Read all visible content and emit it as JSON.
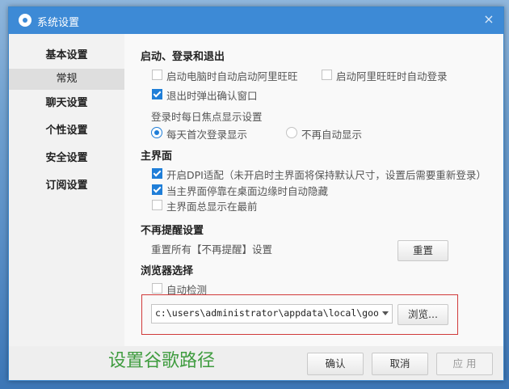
{
  "window": {
    "title": "系统设置",
    "close_glyph": "×"
  },
  "sidebar": {
    "items": [
      {
        "label": "基本设置"
      },
      {
        "label": "常规"
      },
      {
        "label": "聊天设置"
      },
      {
        "label": "个性设置"
      },
      {
        "label": "安全设置"
      },
      {
        "label": "订阅设置"
      }
    ]
  },
  "startup": {
    "title": "启动、登录和退出",
    "auto_start": {
      "label": "启动电脑时自动启动阿里旺旺",
      "checked": false
    },
    "auto_login": {
      "label": "启动阿里旺旺时自动登录",
      "checked": false
    },
    "exit_confirm": {
      "label": "退出时弹出确认窗口",
      "checked": true
    },
    "focus_label": "登录时每日焦点显示设置",
    "focus_first": {
      "label": "每天首次登录显示",
      "selected": true
    },
    "focus_never": {
      "label": "不再自动显示",
      "selected": false
    }
  },
  "main_ui": {
    "title": "主界面",
    "dpi": {
      "label": "开启DPI适配（未开启时主界面将保持默认尺寸，设置后需要重新登录）",
      "checked": true
    },
    "auto_hide": {
      "label": "当主界面停靠在桌面边缘时自动隐藏",
      "checked": true
    },
    "always_top": {
      "label": "主界面总显示在最前",
      "checked": false
    }
  },
  "reminder": {
    "title": "不再提醒设置",
    "label": "重置所有【不再提醒】设置",
    "reset_button": "重置"
  },
  "browser": {
    "title": "浏览器选择",
    "auto_detect": {
      "label": "自动检测",
      "checked": false
    },
    "path_value": "c:\\users\\administrator\\appdata\\local\\google\\chrome",
    "browse_button": "浏览..."
  },
  "annotation": {
    "text": "设置谷歌路径",
    "box_color": "#d03a3a",
    "text_color": "#3f9c3f"
  },
  "footer": {
    "ok": "确认",
    "cancel": "取消",
    "apply": "应 用"
  },
  "colors": {
    "title_bar": "#3d8ad6",
    "accent": "#1f7ed8"
  }
}
